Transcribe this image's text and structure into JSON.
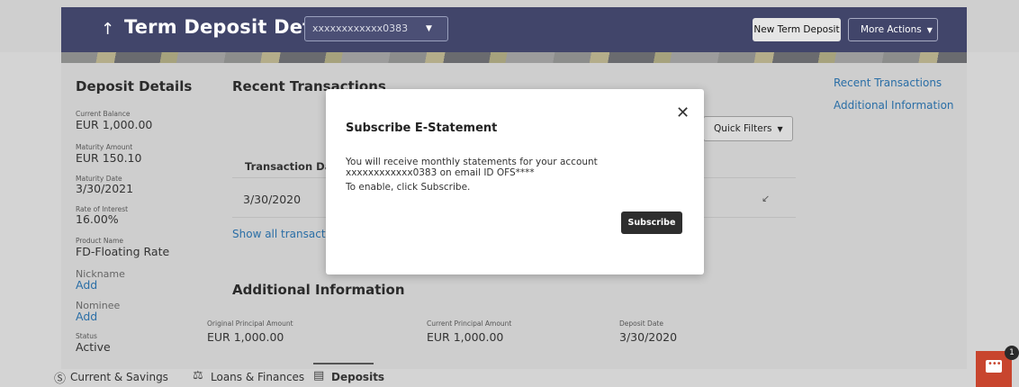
{
  "header": {
    "back_icon": "arrow-up-icon",
    "title": "Term Deposit Details",
    "account_value": "xxxxxxxxxxxx0383",
    "new_button": "New Term Deposit",
    "more_button": "More Actions"
  },
  "sidebar": {
    "title": "Deposit Details",
    "items": [
      {
        "label": "Current Balance",
        "value": "EUR 1,000.00"
      },
      {
        "label": "Maturity Amount",
        "value": "EUR 150.10"
      },
      {
        "label": "Maturity Date",
        "value": "3/30/2021"
      },
      {
        "label": "Rate of Interest",
        "value": "16.00%"
      },
      {
        "label": "Product Name",
        "value": "FD-Floating Rate"
      },
      {
        "label": "Nickname",
        "value": "Add"
      },
      {
        "label": "Nominee",
        "value": "Add"
      },
      {
        "label": "Status",
        "value": "Active"
      }
    ]
  },
  "recent": {
    "title": "Recent Transactions",
    "quick_filters": "Quick Filters",
    "col_date": "Transaction Date",
    "rows": [
      {
        "date": "3/30/2020"
      }
    ],
    "show_all": "Show all transactions"
  },
  "additional": {
    "title": "Additional Information",
    "fields": [
      {
        "label": "Original Principal Amount",
        "value": "EUR 1,000.00"
      },
      {
        "label": "Current Principal Amount",
        "value": "EUR 1,000.00"
      },
      {
        "label": "Deposit Date",
        "value": "3/30/2020"
      }
    ]
  },
  "right_links": [
    "Recent Transactions",
    "Additional Information"
  ],
  "tabs": [
    {
      "label": "Current & Savings",
      "icon": "dollar-circle-icon"
    },
    {
      "label": "Loans & Finances",
      "icon": "loan-icon"
    },
    {
      "label": "Deposits",
      "icon": "deposit-icon",
      "active": true
    }
  ],
  "chat": {
    "badge": "1",
    "icon": "chat-icon"
  },
  "modal": {
    "title": "Subscribe E-Statement",
    "message": "You will receive monthly statements for your account xxxxxxxxxxxx0383 on email ID OFS****",
    "message2": "To enable, click Subscribe.",
    "button": "Subscribe"
  },
  "colors": {
    "header": "#41456a",
    "link": "#2a6ea6",
    "chat": "#c8452e"
  }
}
